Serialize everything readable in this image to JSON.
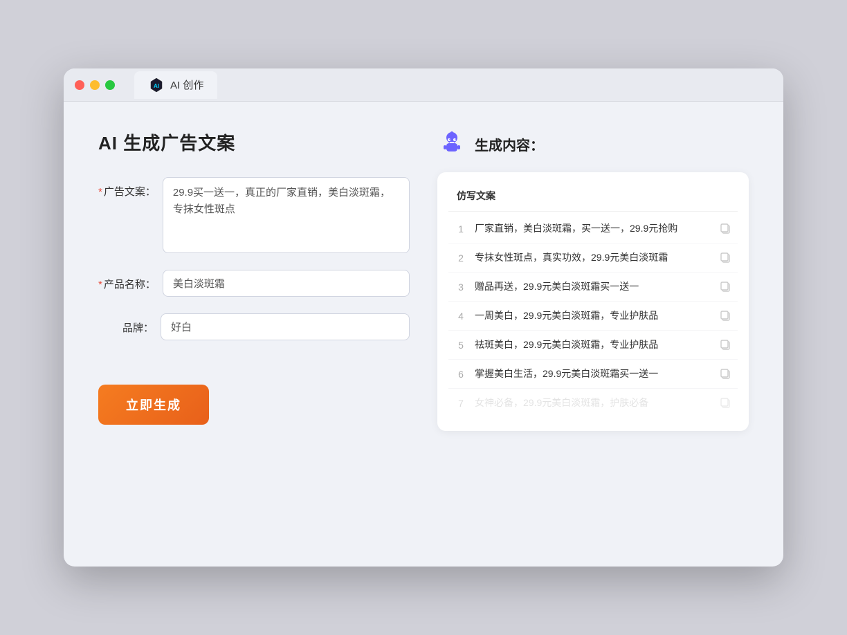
{
  "browser": {
    "tab_label": "AI 创作"
  },
  "page": {
    "title": "AI 生成广告文案",
    "result_title": "生成内容："
  },
  "form": {
    "ad_copy_label": "广告文案：",
    "ad_copy_required": "*",
    "ad_copy_value": "29.9买一送一，真正的厂家直销，美白淡斑霜，专抹女性斑点",
    "product_name_label": "产品名称：",
    "product_name_required": "*",
    "product_name_value": "美白淡斑霜",
    "brand_label": "品牌：",
    "brand_value": "好白",
    "generate_button": "立即生成"
  },
  "result": {
    "column_header": "仿写文案",
    "items": [
      {
        "num": "1",
        "text": "厂家直销，美白淡斑霜，买一送一，29.9元抢购"
      },
      {
        "num": "2",
        "text": "专抹女性斑点，真实功效，29.9元美白淡斑霜"
      },
      {
        "num": "3",
        "text": "赠品再送，29.9元美白淡斑霜买一送一"
      },
      {
        "num": "4",
        "text": "一周美白，29.9元美白淡斑霜，专业护肤品"
      },
      {
        "num": "5",
        "text": "祛斑美白，29.9元美白淡斑霜，专业护肤品"
      },
      {
        "num": "6",
        "text": "掌握美白生活，29.9元美白淡斑霜买一送一"
      },
      {
        "num": "7",
        "text": "女神必备，29.9元美白淡斑霜，护肤必备"
      }
    ]
  }
}
